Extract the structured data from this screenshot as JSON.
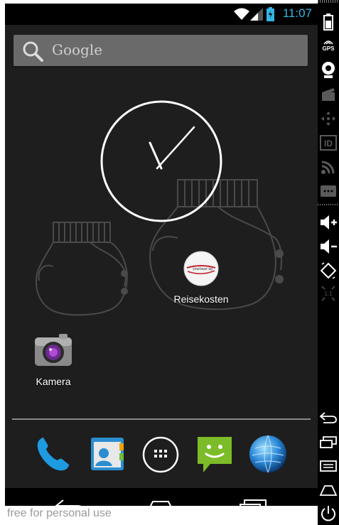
{
  "status_bar": {
    "time": "11:07"
  },
  "search": {
    "label": "Google"
  },
  "desktop": {
    "apps": [
      {
        "label": "Reisekosten",
        "icon": "yourbase-icon",
        "logo_text": "yourbase ag"
      },
      {
        "label": "Kamera",
        "icon": "camera-icon"
      }
    ]
  },
  "dock": {
    "items": [
      "phone-icon",
      "contacts-icon",
      "app-drawer-icon",
      "messaging-icon",
      "browser-icon"
    ]
  },
  "navbar": {
    "buttons": [
      "back-icon",
      "home-icon",
      "recent-apps-icon"
    ]
  },
  "watermark": "free for personal use",
  "sidebar": {
    "gps_label": "GPS",
    "id_label": "ID",
    "scale_label": "1:1",
    "items": [
      "battery-icon",
      "gps-icon",
      "camera-icon",
      "clapper-icon",
      "dpad-icon",
      "id-icon",
      "rss-icon",
      "sms-icon",
      "volume-up-icon",
      "volume-down-icon",
      "rotate-icon",
      "scale-icon",
      "back-icon",
      "recent-apps-icon",
      "menu-icon",
      "home-icon",
      "power-icon"
    ]
  },
  "colors": {
    "accent": "#33b5e5",
    "background": "#1e1e1e"
  }
}
